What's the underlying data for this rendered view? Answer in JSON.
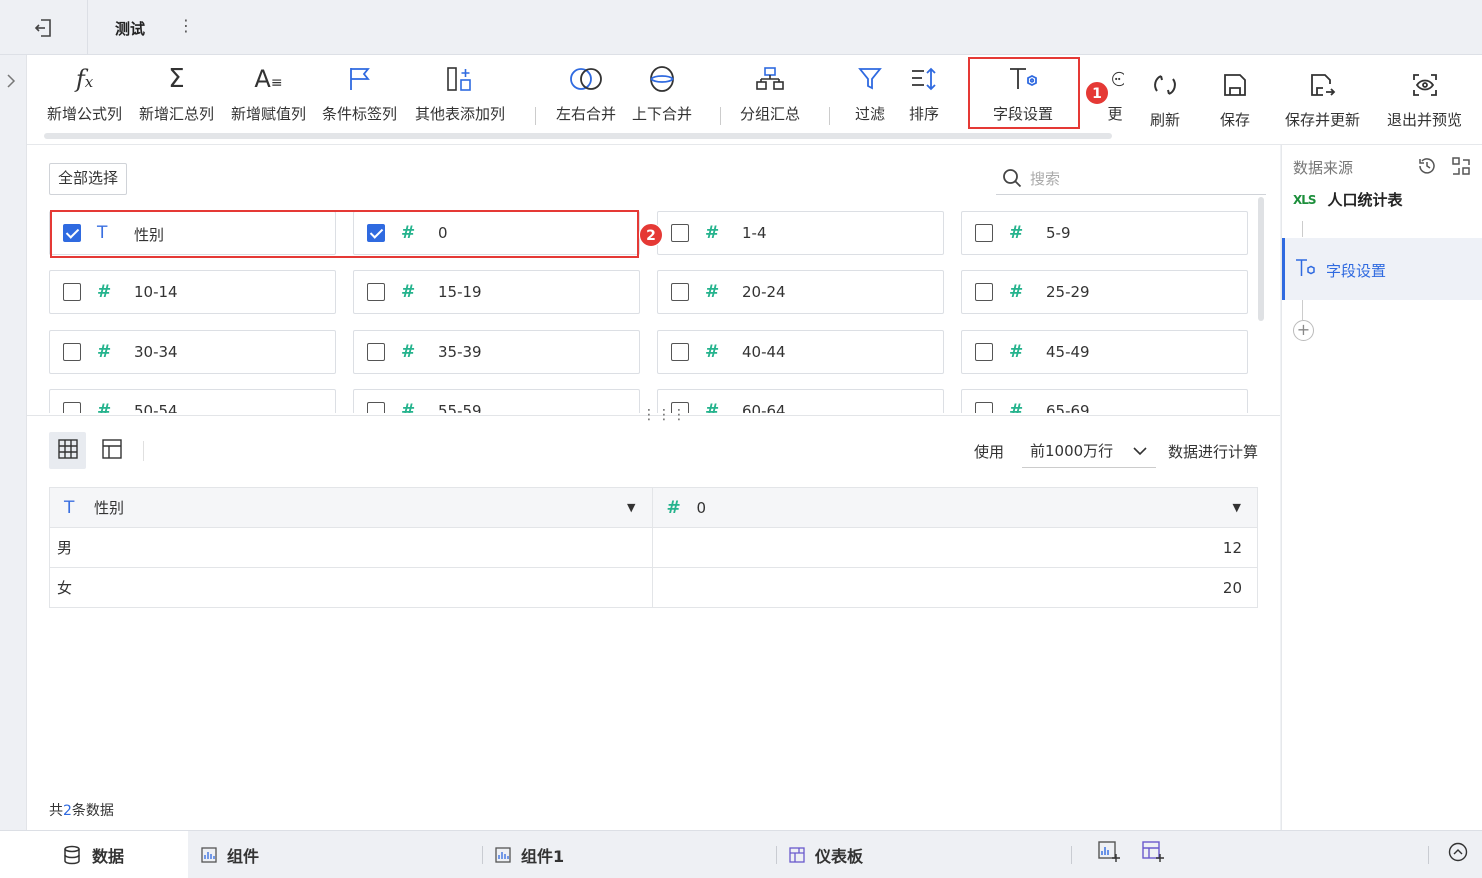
{
  "header": {
    "title": "测试"
  },
  "toolbar": {
    "buttons": [
      {
        "label": "新增公式列",
        "icon": "fx-icon"
      },
      {
        "label": "新增汇总列",
        "icon": "sigma-icon"
      },
      {
        "label": "新增赋值列",
        "icon": "assign-icon"
      },
      {
        "label": "条件标签列",
        "icon": "flag-icon"
      },
      {
        "label": "其他表添加列",
        "icon": "add-column-icon"
      },
      {
        "label": "左右合并",
        "icon": "merge-lr-icon"
      },
      {
        "label": "上下合并",
        "icon": "merge-tb-icon"
      },
      {
        "label": "分组汇总",
        "icon": "group-icon"
      },
      {
        "label": "过滤",
        "icon": "filter-icon"
      },
      {
        "label": "排序",
        "icon": "sort-icon"
      },
      {
        "label": "字段设置",
        "icon": "field-settings-icon"
      },
      {
        "label": "更",
        "icon": "more-icon"
      },
      {
        "label": "刷新",
        "icon": "refresh-icon"
      },
      {
        "label": "保存",
        "icon": "save-icon"
      },
      {
        "label": "保存并更新",
        "icon": "save-update-icon"
      },
      {
        "label": "退出并预览",
        "icon": "exit-preview-icon"
      }
    ],
    "badge1": "1"
  },
  "fields": {
    "select_all": "全部选择",
    "search_placeholder": "搜索",
    "badge2": "2",
    "items": [
      {
        "name": "性别",
        "type": "T",
        "checked": true
      },
      {
        "name": "0",
        "type": "#",
        "checked": true
      },
      {
        "name": "1-4",
        "type": "#",
        "checked": false
      },
      {
        "name": "5-9",
        "type": "#",
        "checked": false
      },
      {
        "name": "10-14",
        "type": "#",
        "checked": false
      },
      {
        "name": "15-19",
        "type": "#",
        "checked": false
      },
      {
        "name": "20-24",
        "type": "#",
        "checked": false
      },
      {
        "name": "25-29",
        "type": "#",
        "checked": false
      },
      {
        "name": "30-34",
        "type": "#",
        "checked": false
      },
      {
        "name": "35-39",
        "type": "#",
        "checked": false
      },
      {
        "name": "40-44",
        "type": "#",
        "checked": false
      },
      {
        "name": "45-49",
        "type": "#",
        "checked": false
      },
      {
        "name": "50-54",
        "type": "#",
        "checked": false
      },
      {
        "name": "55-59",
        "type": "#",
        "checked": false
      },
      {
        "name": "60-64",
        "type": "#",
        "checked": false
      },
      {
        "name": "65-69",
        "type": "#",
        "checked": false
      }
    ]
  },
  "preview": {
    "use_label": "使用",
    "rows_option": "前1000万行",
    "calc_label": "数据进行计算",
    "columns": [
      {
        "name": "性别",
        "type": "T"
      },
      {
        "name": "0",
        "type": "#"
      }
    ],
    "rows": [
      [
        "男",
        "12"
      ],
      [
        "女",
        "20"
      ]
    ],
    "total_prefix": "共",
    "total_count": "2",
    "total_suffix": "条数据"
  },
  "right_panel": {
    "title": "数据来源",
    "source_badge": "XLS",
    "source_name": "人口统计表",
    "step_label": "字段设置",
    "add_label": "+"
  },
  "bottom_tabs": [
    {
      "label": "数据",
      "icon": "database-icon"
    },
    {
      "label": "组件",
      "icon": "chart-icon"
    },
    {
      "label": "组件1",
      "icon": "chart-icon"
    },
    {
      "label": "仪表板",
      "icon": "dashboard-icon"
    }
  ]
}
